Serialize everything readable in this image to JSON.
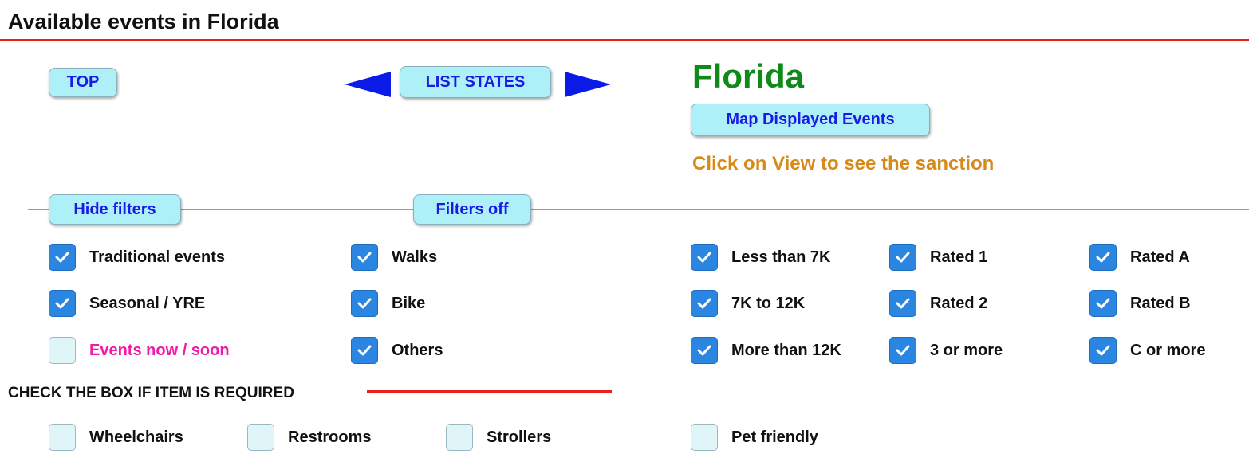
{
  "header": {
    "title": "Available events in Florida"
  },
  "nav": {
    "top_label": "TOP",
    "list_states_label": "LIST STATES",
    "prev_icon": "arrow-left-icon",
    "next_icon": "arrow-right-icon"
  },
  "state": {
    "name": "Florida",
    "map_button_label": "Map Displayed Events",
    "sanction_note": "Click on View to see the sanction"
  },
  "filters": {
    "hide_label": "Hide filters",
    "off_label": "Filters off",
    "event_type": [
      {
        "label": "Traditional events",
        "checked": true
      },
      {
        "label": "Seasonal / YRE",
        "checked": true
      },
      {
        "label": "Events now / soon",
        "checked": false,
        "color": "#f01aa8"
      }
    ],
    "activity": [
      {
        "label": "Walks",
        "checked": true
      },
      {
        "label": "Bike",
        "checked": true
      },
      {
        "label": "Others",
        "checked": true
      }
    ],
    "distance": [
      {
        "label": "Less than 7K",
        "checked": true
      },
      {
        "label": "7K to 12K",
        "checked": true
      },
      {
        "label": "More than 12K",
        "checked": true
      }
    ],
    "rating_number": [
      {
        "label": "Rated 1",
        "checked": true
      },
      {
        "label": "Rated 2",
        "checked": true
      },
      {
        "label": "3 or more",
        "checked": true
      }
    ],
    "rating_letter": [
      {
        "label": "Rated A",
        "checked": true
      },
      {
        "label": "Rated B",
        "checked": true
      },
      {
        "label": "C or more",
        "checked": true
      }
    ]
  },
  "requirements": {
    "heading": "CHECK THE BOX IF ITEM IS REQUIRED",
    "items": [
      {
        "label": "Wheelchairs",
        "checked": false
      },
      {
        "label": "Restrooms",
        "checked": false
      },
      {
        "label": "Strollers",
        "checked": false
      },
      {
        "label": "Pet friendly",
        "checked": false
      }
    ]
  },
  "colors": {
    "accent_rule": "#e82020",
    "button_bg": "#aef0f8",
    "button_text": "#1a1ae6",
    "state_title": "#0f8a1a",
    "sanction_note": "#d68a1a",
    "checkbox_checked": "#2a86e0",
    "checkbox_unchecked": "#dff5f7"
  }
}
